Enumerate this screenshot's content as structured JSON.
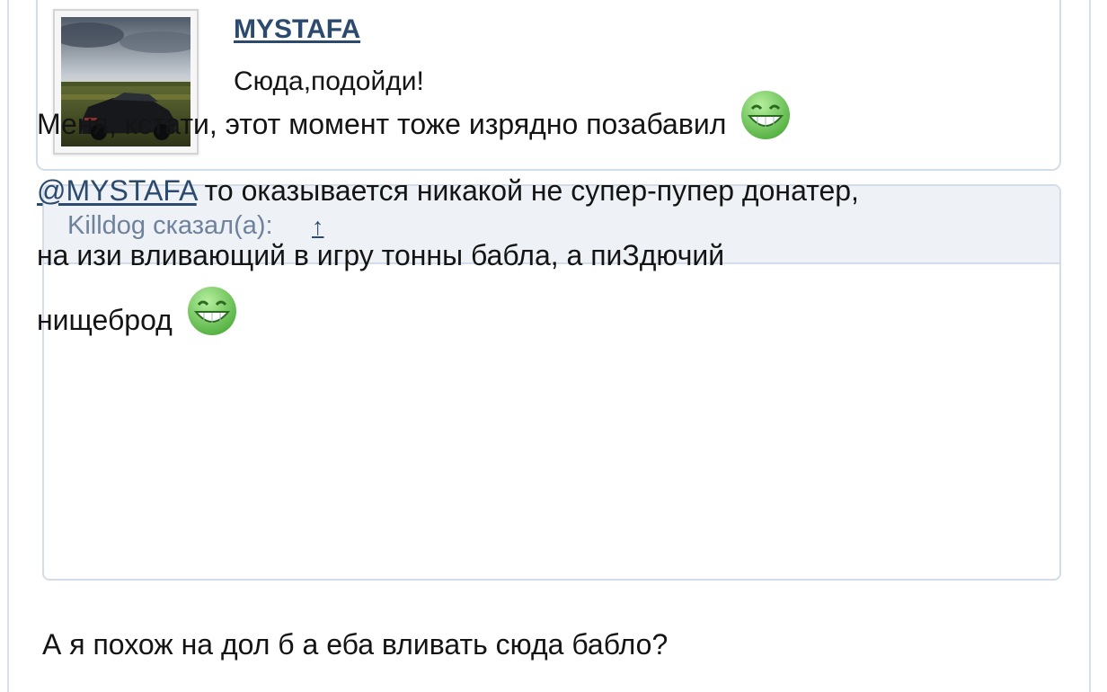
{
  "member": {
    "name": "MYSTAFA",
    "status": "Сюда,подойди!"
  },
  "quote": {
    "author_label": "Killdog сказал(а):",
    "jump_arrow": "↑",
    "line1_text": "Меня, кстати, этот момент тоже изрядно позабавил",
    "line2_mention": "@MYSTAFA",
    "line2_text": " то оказывается никакой не супер-пупер донатер,",
    "line3_text": "на изи вливающий в игру тонны бабла, а пиЗдючий",
    "line4_text": "нищеброд",
    "smiley_icon": "grin-smiley-icon"
  },
  "reply": {
    "text": "А я похож на дол б а еба вливать сюда бабло?"
  },
  "colors": {
    "link": "#2b4a6e",
    "quote_header_bg": "#eef2f7",
    "border": "#d3dde9",
    "quote_author": "#6f829c",
    "smiley_green": "#7ed06b"
  }
}
